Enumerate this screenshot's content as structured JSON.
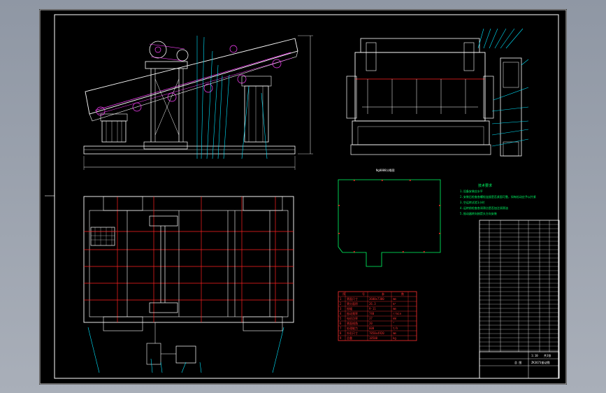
{
  "drawing": {
    "cover_plate_label": "Ng0000分格图",
    "tech_requirements_title": "技术要求",
    "tech_notes": [
      "1.设备安装应水平",
      "2.安装后检查各螺栓连接是否紧固可靠，如有松动应予以拧紧",
      "3.空运转试验1小时",
      "4.运转前检查各润滑点是否加注润滑油",
      "5.振动器转向按箭头方向安装"
    ],
    "param_table_headers": [
      "序",
      "号",
      "参",
      "数"
    ],
    "param_rows": [
      [
        "1",
        "筛面尺寸",
        "3600x7300",
        "mm"
      ],
      [
        "2",
        "筛分面积",
        "26.3",
        "m²"
      ],
      [
        "3",
        "振幅",
        "9-11",
        "mm"
      ],
      [
        "4",
        "振动频率",
        "740",
        "r/min"
      ],
      [
        "5",
        "电机功率",
        "37",
        "kW"
      ],
      [
        "6",
        "筛面倾角",
        "20",
        "°"
      ],
      [
        "7",
        "处理能力",
        "600",
        "t/h"
      ],
      [
        "8",
        "外形尺寸",
        "7850x4920",
        "mm"
      ],
      [
        "9",
        "总重",
        "18500",
        "kg"
      ]
    ],
    "title_block": {
      "name": "总 图",
      "drawing_no": "ZK3673振动筛",
      "scale": "1:10",
      "sheet": "共1张"
    }
  },
  "colors": {
    "frame": "#ffffff",
    "leader": "#00e5ff",
    "centerline": "#ff2020",
    "dimension": "#ff40ff",
    "cover": "#00ff66",
    "param_table": "#ff3030"
  }
}
